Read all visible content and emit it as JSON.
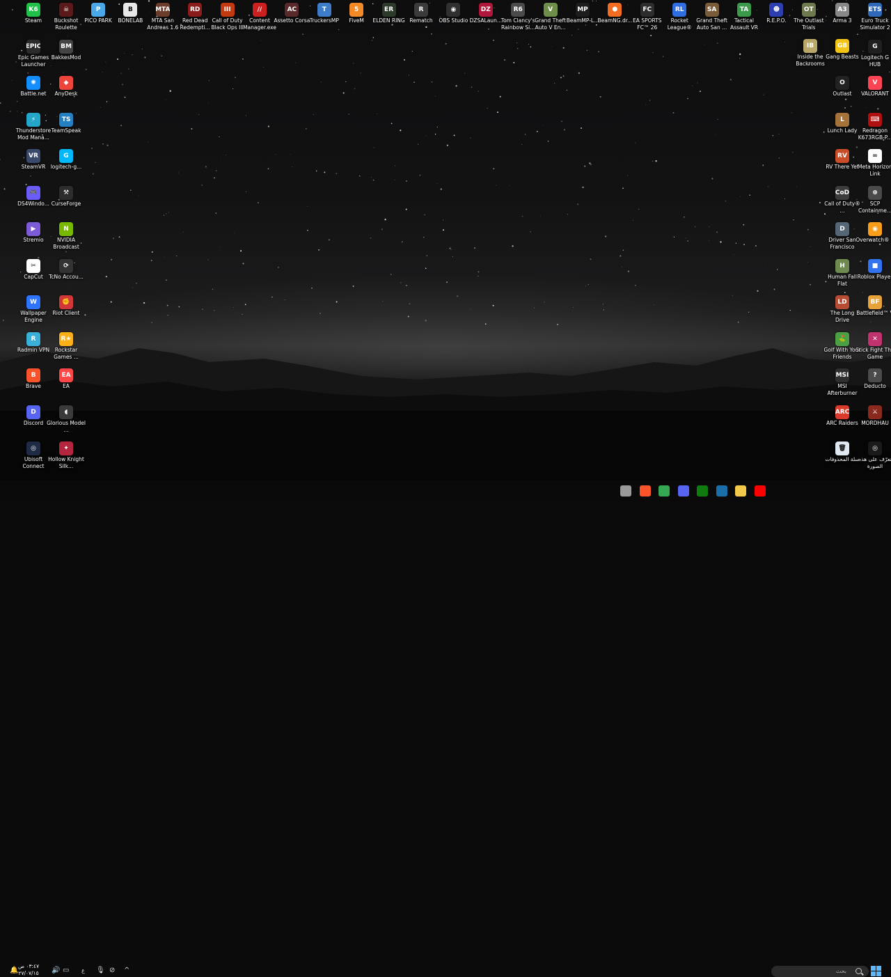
{
  "desktop": {
    "background": "night sky with stars and misty mountains",
    "columns": [
      {
        "col": "left1",
        "items": [
          {
            "label": "Steam",
            "icon": "k6-icon",
            "color": "#21c04a",
            "glyph": "K6"
          },
          {
            "label": "Epic Games Launcher",
            "icon": "epic-games-icon",
            "color": "#2b2b2b",
            "glyph": "EPIC"
          },
          {
            "label": "Battle.net",
            "icon": "battlenet-icon",
            "color": "#148eff",
            "glyph": "✺"
          },
          {
            "label": "Thunderstore Mod Mana...",
            "icon": "thunderstore-icon",
            "color": "#23a6c7",
            "glyph": "⚡"
          },
          {
            "label": "SteamVR",
            "icon": "steamvr-icon",
            "color": "#3a4a6b",
            "glyph": "VR"
          },
          {
            "label": "DS4Windo...",
            "icon": "gamepad-icon",
            "color": "#6a5cff",
            "glyph": "🎮"
          },
          {
            "label": "Stremio",
            "icon": "stremio-icon",
            "color": "#7b5bd6",
            "glyph": "▶"
          },
          {
            "label": "CapCut",
            "icon": "capcut-icon",
            "color": "#ffffff",
            "glyph": "✂"
          },
          {
            "label": "Wallpaper Engine",
            "icon": "wallpaper-engine-icon",
            "color": "#2f74ff",
            "glyph": "W"
          },
          {
            "label": "Radmin VPN",
            "icon": "radmin-icon",
            "color": "#3ab0d9",
            "glyph": "R"
          },
          {
            "label": "Brave",
            "icon": "brave-icon",
            "color": "#fb542b",
            "glyph": "B"
          },
          {
            "label": "Discord",
            "icon": "discord-icon",
            "color": "#5865f2",
            "glyph": "D"
          },
          {
            "label": "Ubisoft Connect",
            "icon": "ubisoft-icon",
            "color": "#1f2a44",
            "glyph": "◎"
          }
        ]
      },
      {
        "col": "left2",
        "items": [
          {
            "label": "Buckshot Roulette",
            "icon": "buckshot-icon",
            "color": "#5a1a1a",
            "glyph": "☠"
          },
          {
            "label": "BakkesMod",
            "icon": "bakkesmod-icon",
            "color": "#444444",
            "glyph": "BM"
          },
          {
            "label": "AnyDesk",
            "icon": "anydesk-icon",
            "color": "#ef443b",
            "glyph": "◆"
          },
          {
            "label": "TeamSpeak",
            "icon": "teamspeak-icon",
            "color": "#2580c3",
            "glyph": "TS"
          },
          {
            "label": "logitech-g...",
            "icon": "logitech-icon",
            "color": "#00b8fc",
            "glyph": "G"
          },
          {
            "label": "CurseForge",
            "icon": "curseforge-icon",
            "color": "#2d2d2d",
            "glyph": "⚒"
          },
          {
            "label": "NVIDIA Broadcast",
            "icon": "nvidia-icon",
            "color": "#76b900",
            "glyph": "N"
          },
          {
            "label": "TcNo Accou...",
            "icon": "tcno-icon",
            "color": "#333333",
            "glyph": "⟳"
          },
          {
            "label": "Riot Client",
            "icon": "riot-icon",
            "color": "#d13639",
            "glyph": "✊"
          },
          {
            "label": "Rockstar Games ...",
            "icon": "rockstar-icon",
            "color": "#fcaf17",
            "glyph": "R★"
          },
          {
            "label": "EA",
            "icon": "ea-icon",
            "color": "#ff4747",
            "glyph": "EA"
          },
          {
            "label": "Glorious Model ...",
            "icon": "glorious-icon",
            "color": "#3a3a3a",
            "glyph": "◖"
          },
          {
            "label": "Hollow Knight Silk...",
            "icon": "silksong-icon",
            "color": "#b3263d",
            "glyph": "✦"
          }
        ]
      },
      {
        "col": "right2",
        "items": [
          {
            "label": "Euro Truck Simulator 2",
            "icon": "ets2-icon",
            "color": "#2e6ab8",
            "glyph": "ETS"
          },
          {
            "label": "Logitech G HUB",
            "icon": "ghub-icon",
            "color": "#202020",
            "glyph": "G"
          },
          {
            "label": "VALORANT",
            "icon": "valorant-icon",
            "color": "#fa4454",
            "glyph": "V"
          },
          {
            "label": "Redragon K673RGB-P...",
            "icon": "redragon-icon",
            "color": "#b01010",
            "glyph": "⌨"
          },
          {
            "label": "Meta Horizon Link",
            "icon": "meta-icon",
            "color": "#ffffff",
            "glyph": "∞"
          },
          {
            "label": "SCP Containme...",
            "icon": "scp-icon",
            "color": "#4a4a4a",
            "glyph": "⊕"
          },
          {
            "label": "Overwatch® 2",
            "icon": "overwatch-icon",
            "color": "#f99e1a",
            "glyph": "◉"
          },
          {
            "label": "Roblox Player",
            "icon": "roblox-icon",
            "color": "#3273f0",
            "glyph": "■"
          },
          {
            "label": "Battlefield™ V",
            "icon": "battlefield-icon",
            "color": "#e8a23a",
            "glyph": "BF"
          },
          {
            "label": "Stick Fight The Game",
            "icon": "stickfight-icon",
            "color": "#c0336f",
            "glyph": "✕"
          },
          {
            "label": "Deducto",
            "icon": "deducto-icon",
            "color": "#4b4b4b",
            "glyph": "?"
          },
          {
            "label": "MORDHAU",
            "icon": "mordhau-icon",
            "color": "#8a2a1e",
            "glyph": "⚔"
          },
          {
            "label": "تعرّف على هذه الصورة",
            "icon": "camera-icon",
            "color": "#1a1a1a",
            "glyph": "◎"
          }
        ]
      },
      {
        "col": "right1",
        "items": [
          {
            "label": "Arma 3",
            "icon": "arma-icon",
            "color": "#888888",
            "glyph": "A3"
          },
          {
            "label": "Gang Beasts",
            "icon": "gangbeasts-icon",
            "color": "#f3c316",
            "glyph": "GB"
          },
          {
            "label": "Outlast",
            "icon": "outlast-icon",
            "color": "#222222",
            "glyph": "O"
          },
          {
            "label": "Lunch Lady",
            "icon": "lunchlady-icon",
            "color": "#a5733a",
            "glyph": "L"
          },
          {
            "label": "RV There Yet",
            "icon": "rvthereyet-icon",
            "color": "#c94e27",
            "glyph": "RV"
          },
          {
            "label": "Call of Duty® ...",
            "icon": "cod-icon",
            "color": "#3c3c3c",
            "glyph": "CoD"
          },
          {
            "label": "Driver San Francisco",
            "icon": "driver-icon",
            "color": "#556677",
            "glyph": "D"
          },
          {
            "label": "Human Fall Flat",
            "icon": "humanfallflat-icon",
            "color": "#6e8a4f",
            "glyph": "H"
          },
          {
            "label": "The Long Drive",
            "icon": "longdrive-icon",
            "color": "#b54c33",
            "glyph": "LD"
          },
          {
            "label": "Golf With Your Friends",
            "icon": "golf-icon",
            "color": "#4aa043",
            "glyph": "⛳"
          },
          {
            "label": "MSI Afterburner",
            "icon": "msi-icon",
            "color": "#2f2f2f",
            "glyph": "MSI"
          },
          {
            "label": "ARC Raiders",
            "icon": "arcraiders-icon",
            "color": "#d93a2b",
            "glyph": "ARC"
          },
          {
            "label": "سلة المحذوفات",
            "icon": "recycle-bin-icon",
            "color": "#dfe8f0",
            "glyph": "🗑"
          }
        ]
      }
    ],
    "top_row": [
      {
        "label": "PICO PARK",
        "icon": "picopark-icon",
        "color": "#4aa8e8",
        "glyph": "P"
      },
      {
        "label": "BONELAB",
        "icon": "bonelab-icon",
        "color": "#e8e8e8",
        "glyph": "B"
      },
      {
        "label": "MTA San Andreas 1.6",
        "icon": "mta-icon",
        "color": "#6b3d2a",
        "glyph": "MTA"
      },
      {
        "label": "Red Dead Redempti...",
        "icon": "rdr-icon",
        "color": "#8a1c1c",
        "glyph": "RD"
      },
      {
        "label": "Call of Duty Black Ops III",
        "icon": "bo3-icon",
        "color": "#c43a10",
        "glyph": "III"
      },
      {
        "label": "Content Manager.exe",
        "icon": "contentmanager-icon",
        "color": "#cc1f1f",
        "glyph": "//"
      },
      {
        "label": "Assetto Corsa",
        "icon": "assetto-icon",
        "color": "#5a2a2a",
        "glyph": "AC"
      },
      {
        "label": "TruckersMP",
        "icon": "truckersmp-icon",
        "color": "#3d7cc9",
        "glyph": "T"
      },
      {
        "label": "FiveM",
        "icon": "fivem-icon",
        "color": "#f38a28",
        "glyph": "5"
      },
      {
        "label": "ELDEN RING",
        "icon": "eldenring-icon",
        "color": "#2c3a2a",
        "glyph": "ER"
      },
      {
        "label": "Rematch",
        "icon": "rematch-icon",
        "color": "#3b3b3b",
        "glyph": "R"
      },
      {
        "label": "OBS Studio",
        "icon": "obs-icon",
        "color": "#303030",
        "glyph": "◉"
      },
      {
        "label": "DZSALaun...",
        "icon": "dzsa-icon",
        "color": "#b0173a",
        "glyph": "DZ"
      },
      {
        "label": "Tom Clancy's Rainbow Si...",
        "icon": "r6-icon",
        "color": "#4a4a4a",
        "glyph": "R6"
      },
      {
        "label": "Grand Theft Auto V En...",
        "icon": "gtav-icon",
        "color": "#6d8f4a",
        "glyph": "V"
      },
      {
        "label": "BeamMP-L...",
        "icon": "beammp-icon",
        "color": "#1d1d1d",
        "glyph": "MP"
      },
      {
        "label": "BeamNG.dr...",
        "icon": "beamng-icon",
        "color": "#f26c22",
        "glyph": "⬢"
      },
      {
        "label": "EA SPORTS FC™ 26",
        "icon": "fc26-icon",
        "color": "#2d2d2d",
        "glyph": "FC"
      },
      {
        "label": "Rocket League®",
        "icon": "rocketleague-icon",
        "color": "#2f6de0",
        "glyph": "RL"
      },
      {
        "label": "Grand Theft Auto San ...",
        "icon": "gtasa-icon",
        "color": "#7a5b3a",
        "glyph": "SA"
      },
      {
        "label": "Tactical Assault VR",
        "icon": "tavr-icon",
        "color": "#3a9a4a",
        "glyph": "TA"
      },
      {
        "label": "R.E.P.O.",
        "icon": "repo-icon",
        "color": "#2d3fb0",
        "glyph": "☻"
      },
      {
        "label": "The Outlast Trials",
        "icon": "outlasttrials-icon",
        "color": "#6e7a4e",
        "glyph": "OT"
      }
    ],
    "extra": [
      {
        "label": "Inside the Backrooms",
        "icon": "backrooms-icon",
        "color": "#b9a86a",
        "glyph": "IB"
      }
    ]
  },
  "taskbar": {
    "clock_time": "٠٣:٤٧ ص",
    "clock_date": "٢٧/٠٧/١٥",
    "lang": "ع",
    "search_placeholder": "بحث",
    "pinned": [
      {
        "icon": "task-app-1-icon",
        "color": "#9a9a9a"
      },
      {
        "icon": "brave-task-icon",
        "color": "#fb542b"
      },
      {
        "icon": "chrome-task-icon",
        "color": "#34a853"
      },
      {
        "icon": "discord-task-icon",
        "color": "#5865f2"
      },
      {
        "icon": "xbox-task-icon",
        "color": "#107c10"
      },
      {
        "icon": "steam-task-icon",
        "color": "#1b6fa8"
      },
      {
        "icon": "file-explorer-task-icon",
        "color": "#f3c94a"
      },
      {
        "icon": "youtube-task-icon",
        "color": "#ff0000"
      }
    ]
  }
}
